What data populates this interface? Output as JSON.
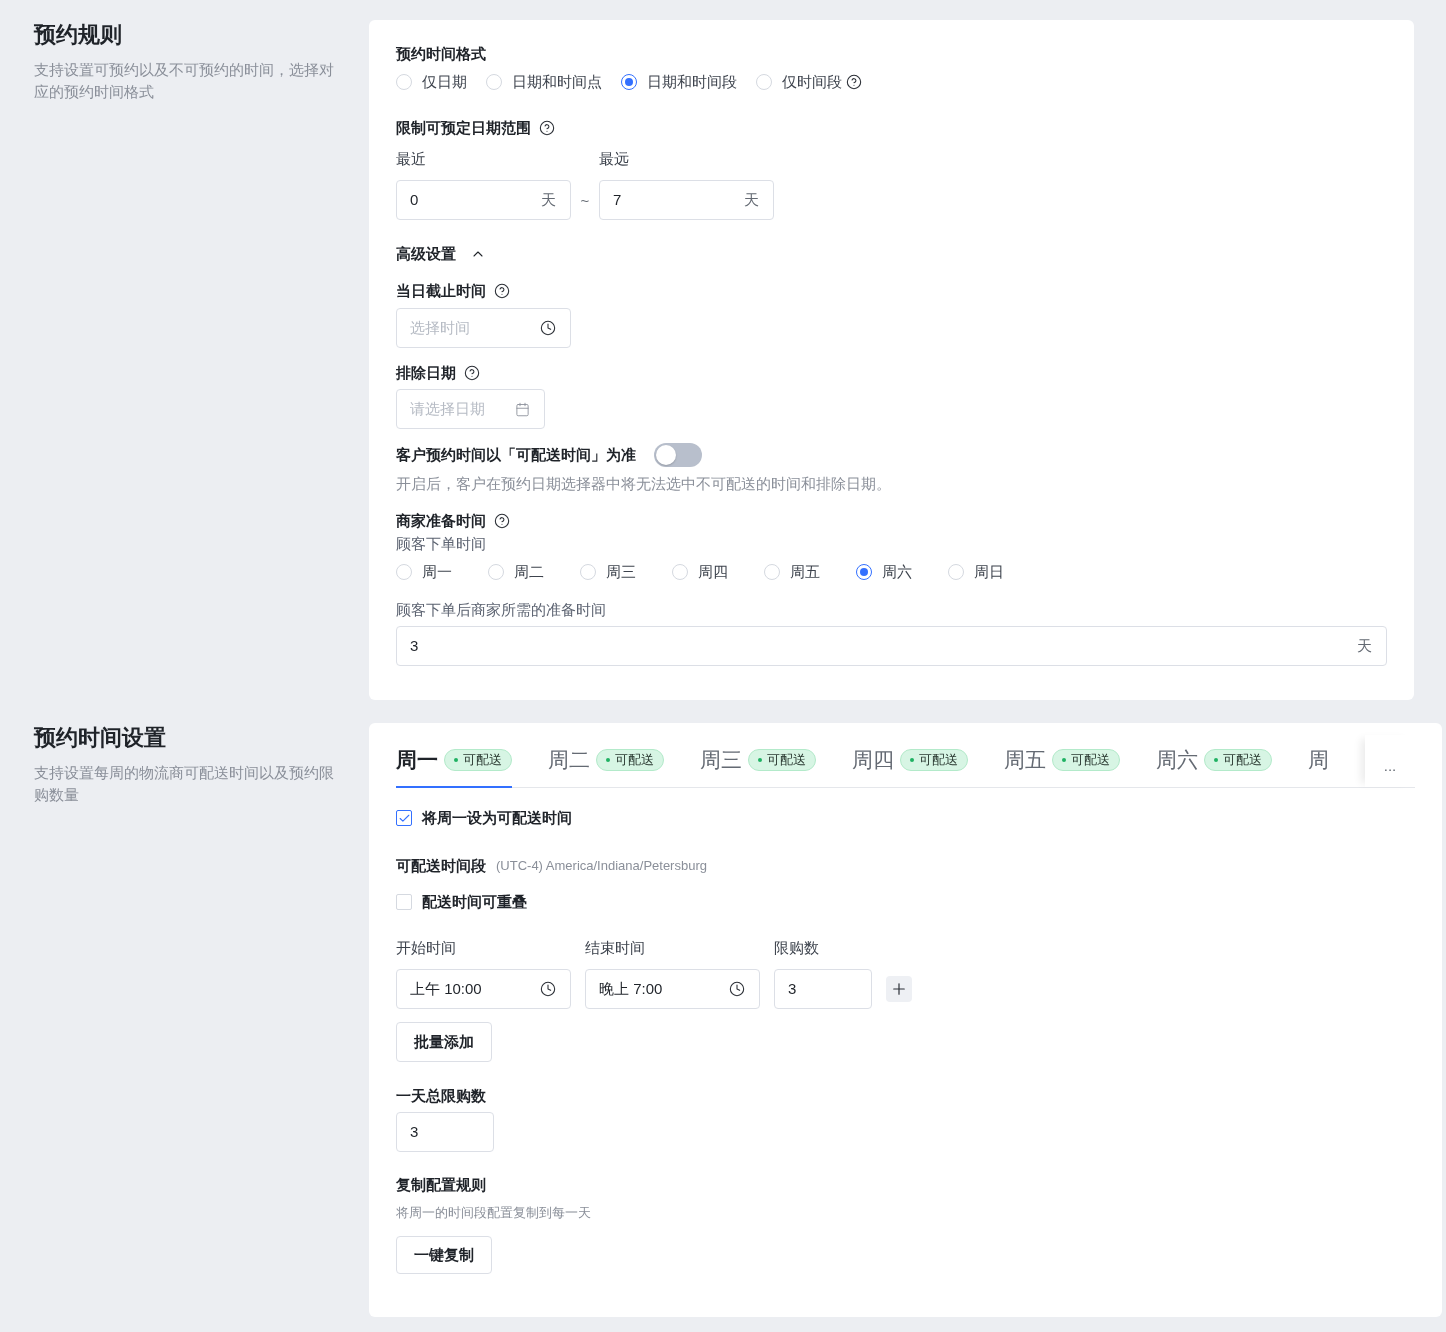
{
  "booking_rules": {
    "title": "预约规则",
    "description": "支持设置可预约以及不可预约的时间，选择对应的预约时间格式",
    "time_format": {
      "label": "预约时间格式",
      "options": [
        {
          "label": "仅日期",
          "selected": false,
          "help": false
        },
        {
          "label": "日期和时间点",
          "selected": false,
          "help": false
        },
        {
          "label": "日期和时间段",
          "selected": true,
          "help": false
        },
        {
          "label": "仅时间段",
          "selected": false,
          "help": true
        }
      ]
    },
    "date_range": {
      "label": "限制可预定日期范围",
      "help": true,
      "nearest": {
        "label": "最近",
        "value": "0",
        "unit": "天"
      },
      "separator": "~",
      "farthest": {
        "label": "最远",
        "value": "7",
        "unit": "天"
      }
    },
    "advanced": {
      "label": "高级设置",
      "expanded": true,
      "cutoff_time": {
        "label": "当日截止时间",
        "help": true,
        "placeholder": "选择时间"
      },
      "excluded_dates": {
        "label": "排除日期",
        "help": true,
        "placeholder": "请选择日期"
      },
      "delivery_time_rule": {
        "label": "客户预约时间以「可配送时间」为准",
        "on": false,
        "hint": "开启后，客户在预约日期选择器中将无法选中不可配送的时间和排除日期。"
      },
      "prep_time": {
        "label": "商家准备时间",
        "help": true,
        "order_day_label": "顾客下单时间",
        "days": [
          {
            "label": "周一",
            "selected": false
          },
          {
            "label": "周二",
            "selected": false
          },
          {
            "label": "周三",
            "selected": false
          },
          {
            "label": "周四",
            "selected": false
          },
          {
            "label": "周五",
            "selected": false
          },
          {
            "label": "周六",
            "selected": true
          },
          {
            "label": "周日",
            "selected": false
          }
        ],
        "duration_label": "顾客下单后商家所需的准备时间",
        "value": "3",
        "unit": "天"
      }
    }
  },
  "time_settings": {
    "title": "预约时间设置",
    "description": "支持设置每周的物流商可配送时间以及预约限购数量",
    "tabs": [
      {
        "label": "周一",
        "badge": "可配送",
        "selected": true
      },
      {
        "label": "周二",
        "badge": "可配送",
        "selected": false
      },
      {
        "label": "周三",
        "badge": "可配送",
        "selected": false
      },
      {
        "label": "周四",
        "badge": "可配送",
        "selected": false
      },
      {
        "label": "周五",
        "badge": "可配送",
        "selected": false
      },
      {
        "label": "周六",
        "badge": "可配送",
        "selected": false
      },
      {
        "label": "周",
        "selected": false
      }
    ],
    "more": "...",
    "enable_day": {
      "label": "将周一设为可配送时间",
      "checked": true
    },
    "slots_label": "可配送时间段",
    "timezone": "(UTC-4) America/Indiana/Petersburg",
    "overlap": {
      "label": "配送时间可重叠",
      "checked": false
    },
    "slot_columns": [
      "开始时间",
      "结束时间",
      "限购数"
    ],
    "slots": [
      {
        "start": "上午 10:00",
        "end": "晚上 7:00",
        "limit": "3"
      }
    ],
    "batch_add": "批量添加",
    "daily_limit": {
      "label": "一天总限购数",
      "value": "3"
    },
    "copy_rules": {
      "label": "复制配置规则",
      "description": "将周一的时间段配置复制到每一天",
      "button": "一键复制"
    }
  }
}
